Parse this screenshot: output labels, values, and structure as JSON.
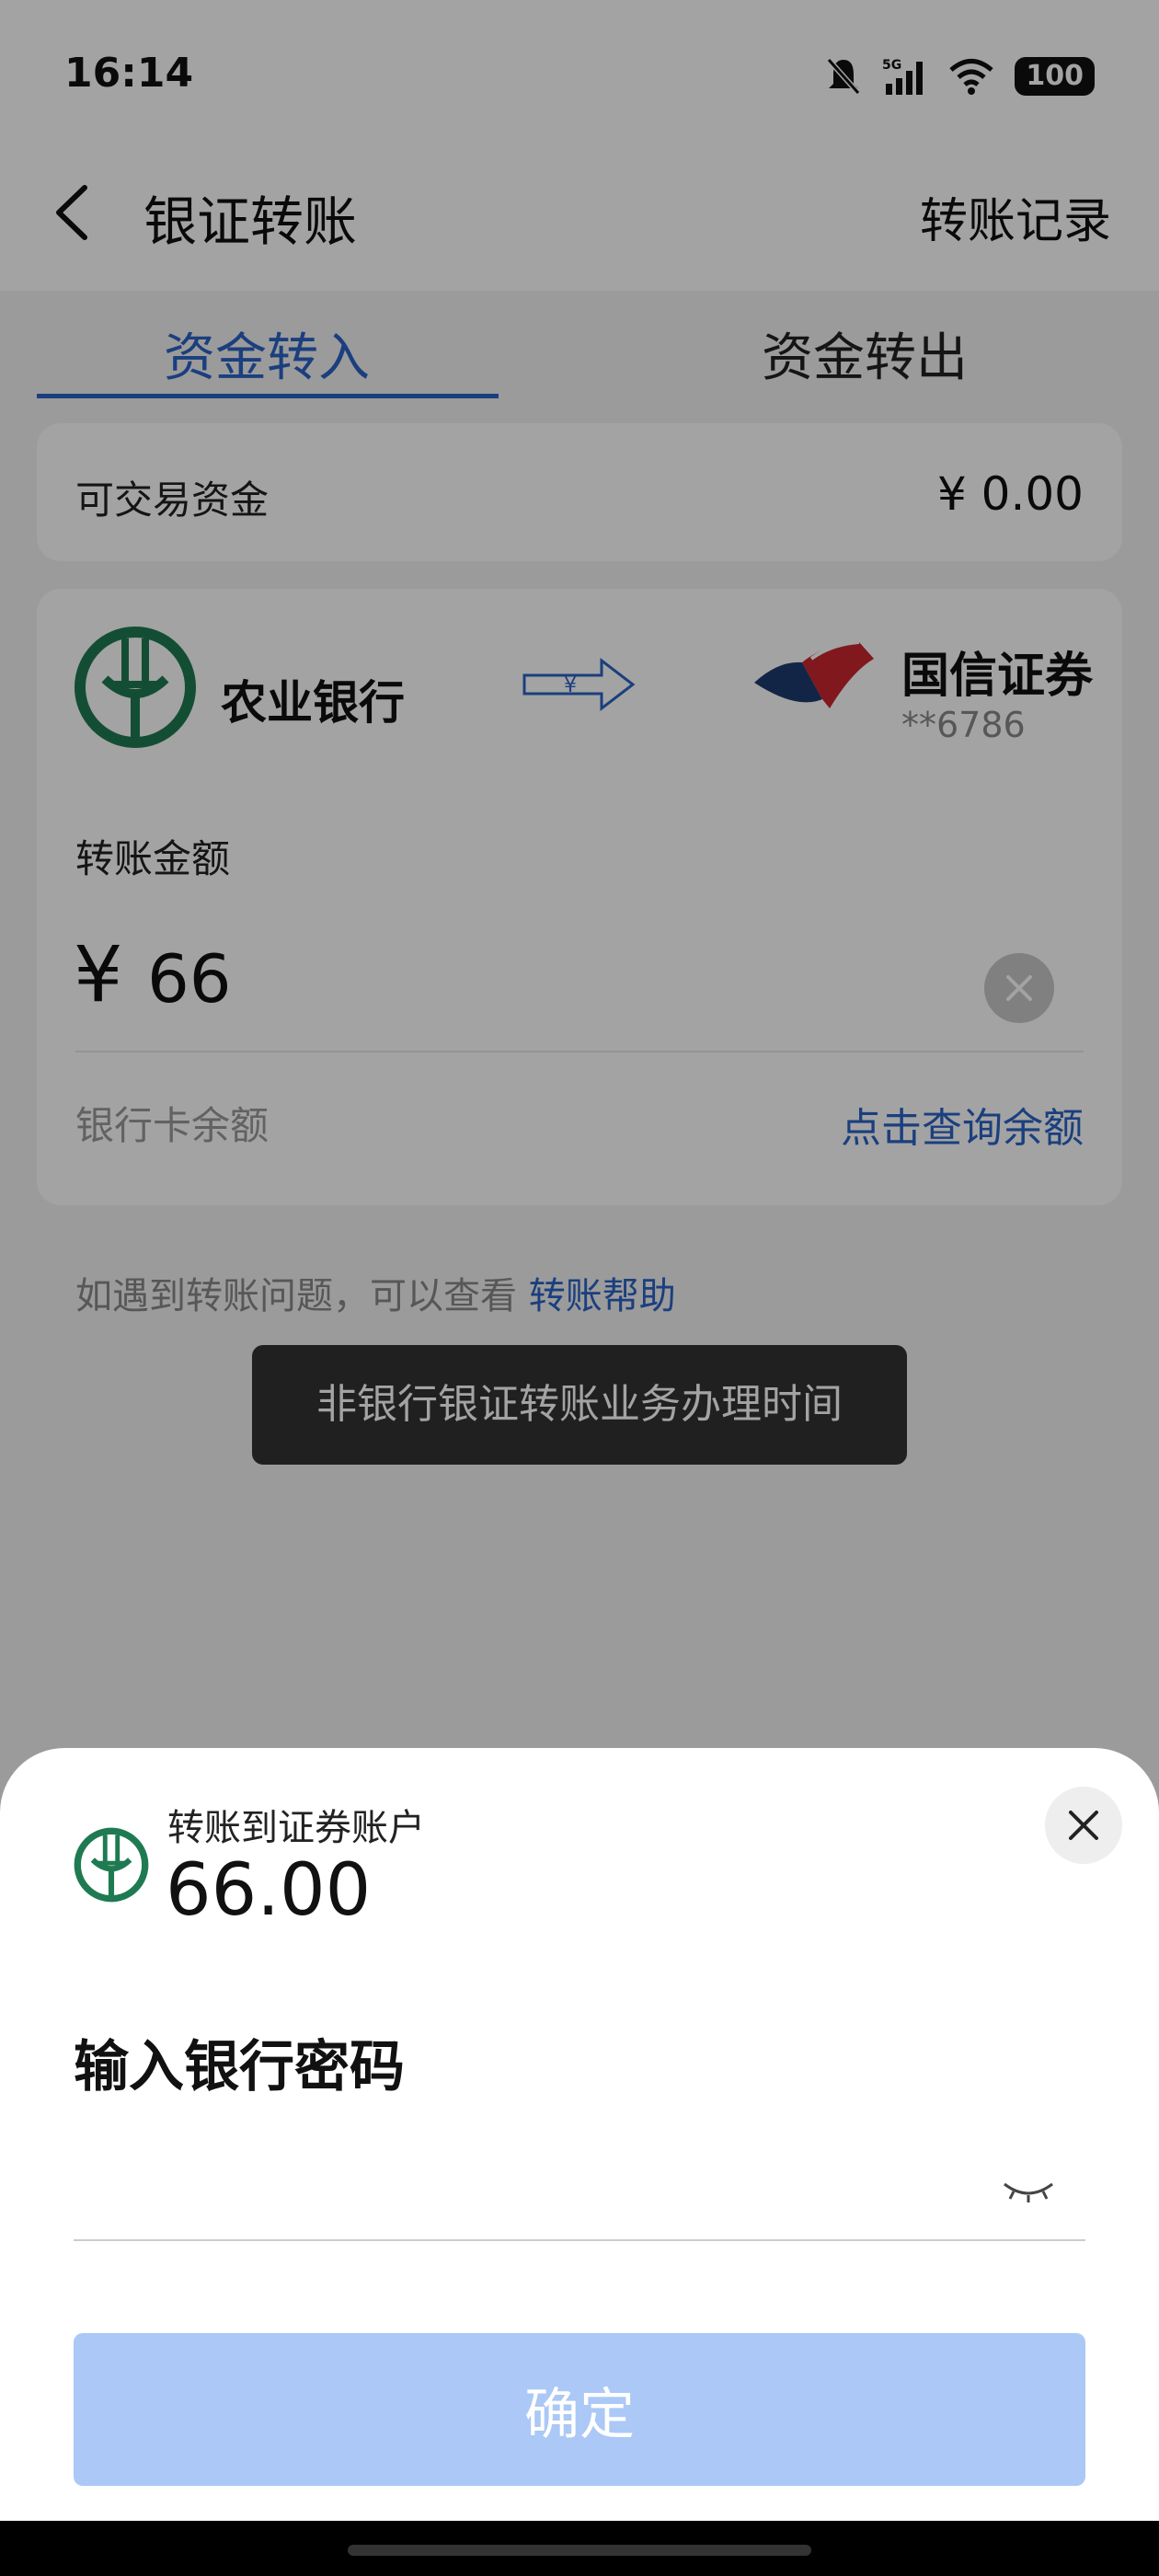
{
  "status_bar": {
    "time": "16:14",
    "battery": "100",
    "network": "5G"
  },
  "nav": {
    "title": "银证转账",
    "right_action": "转账记录"
  },
  "tabs": [
    {
      "label": "资金转入",
      "active": true
    },
    {
      "label": "资金转出",
      "active": false
    }
  ],
  "funds": {
    "label": "可交易资金",
    "value": "¥ 0.00"
  },
  "transfer": {
    "bank_name": "农业银行",
    "securities_name": "国信证券",
    "securities_account": "**6786",
    "arrow_symbol": "¥",
    "amount_label": "转账金额",
    "currency_symbol": "¥",
    "amount": "66",
    "balance_label": "银行卡余额",
    "balance_link": "点击查询余额"
  },
  "help": {
    "text": "如遇到转账问题，可以查看",
    "link": "转账帮助"
  },
  "toast": "非银行银证转账业务办理时间",
  "sheet": {
    "subtitle": "转账到证券账户",
    "amount": "66.00",
    "title": "输入银行密码",
    "password_placeholder": "",
    "confirm_label": "确定"
  },
  "colors": {
    "accent": "#2b63c6",
    "bank_green": "#1f7a52",
    "confirm_disabled": "#abc8f6"
  }
}
